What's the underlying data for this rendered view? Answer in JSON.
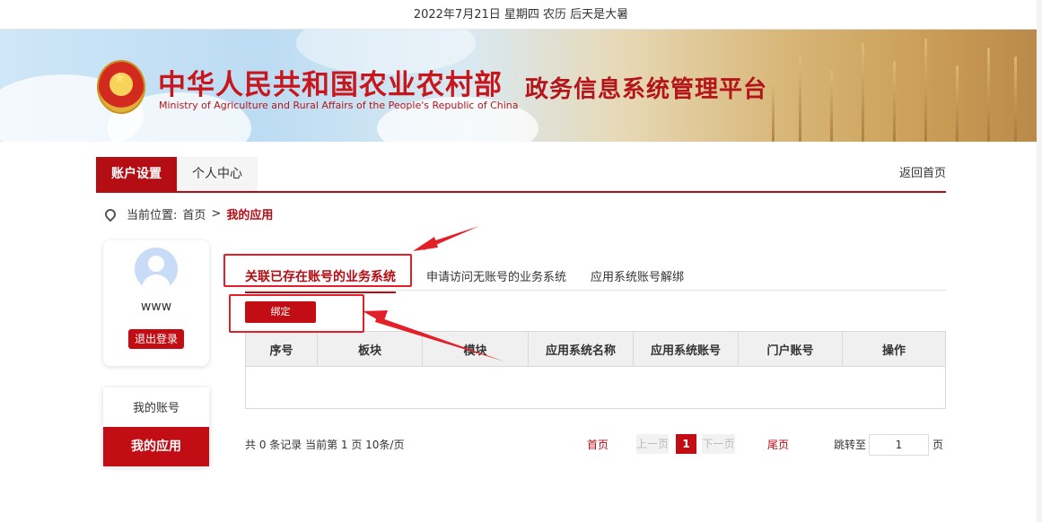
{
  "topbar": {
    "date_text": "2022年7月21日 星期四 农历 后天是大暑"
  },
  "banner": {
    "ministry_cn": "中华人民共和国农业农村部",
    "ministry_en": "Ministry of Agriculture and Rural Affairs of the People's Republic of China",
    "platform_title": "政务信息系统管理平台"
  },
  "nav": {
    "tabs": [
      {
        "label": "账户设置"
      },
      {
        "label": "个人中心"
      }
    ],
    "back_link": "返回首页"
  },
  "breadcrumb": {
    "prefix": "当前位置:",
    "home": "首页",
    "separator": ">",
    "current": "我的应用"
  },
  "user": {
    "name": "www",
    "logout_label": "退出登录"
  },
  "sidemenu": {
    "items": [
      {
        "label": "我的账号"
      },
      {
        "label": "我的应用"
      }
    ]
  },
  "subtabs": [
    {
      "label": "关联已存在账号的业务系统"
    },
    {
      "label": "申请访问无账号的业务系统"
    },
    {
      "label": "应用系统账号解绑"
    }
  ],
  "bind_button": "绑定",
  "table": {
    "columns": [
      "序号",
      "板块",
      "模块",
      "应用系统名称",
      "应用系统账号",
      "门户账号",
      "操作"
    ],
    "rows": []
  },
  "pager": {
    "summary": "共 0 条记录  当前第 1 页  10条/页",
    "first": "首页",
    "prev": "上一页",
    "current_page": "1",
    "next": "下一页",
    "last": "尾页",
    "jump_label": "跳转至",
    "jump_value": "1",
    "page_label": "页"
  },
  "colors": {
    "brand_red": "#c30d14",
    "annotation_red": "#e3202a"
  }
}
